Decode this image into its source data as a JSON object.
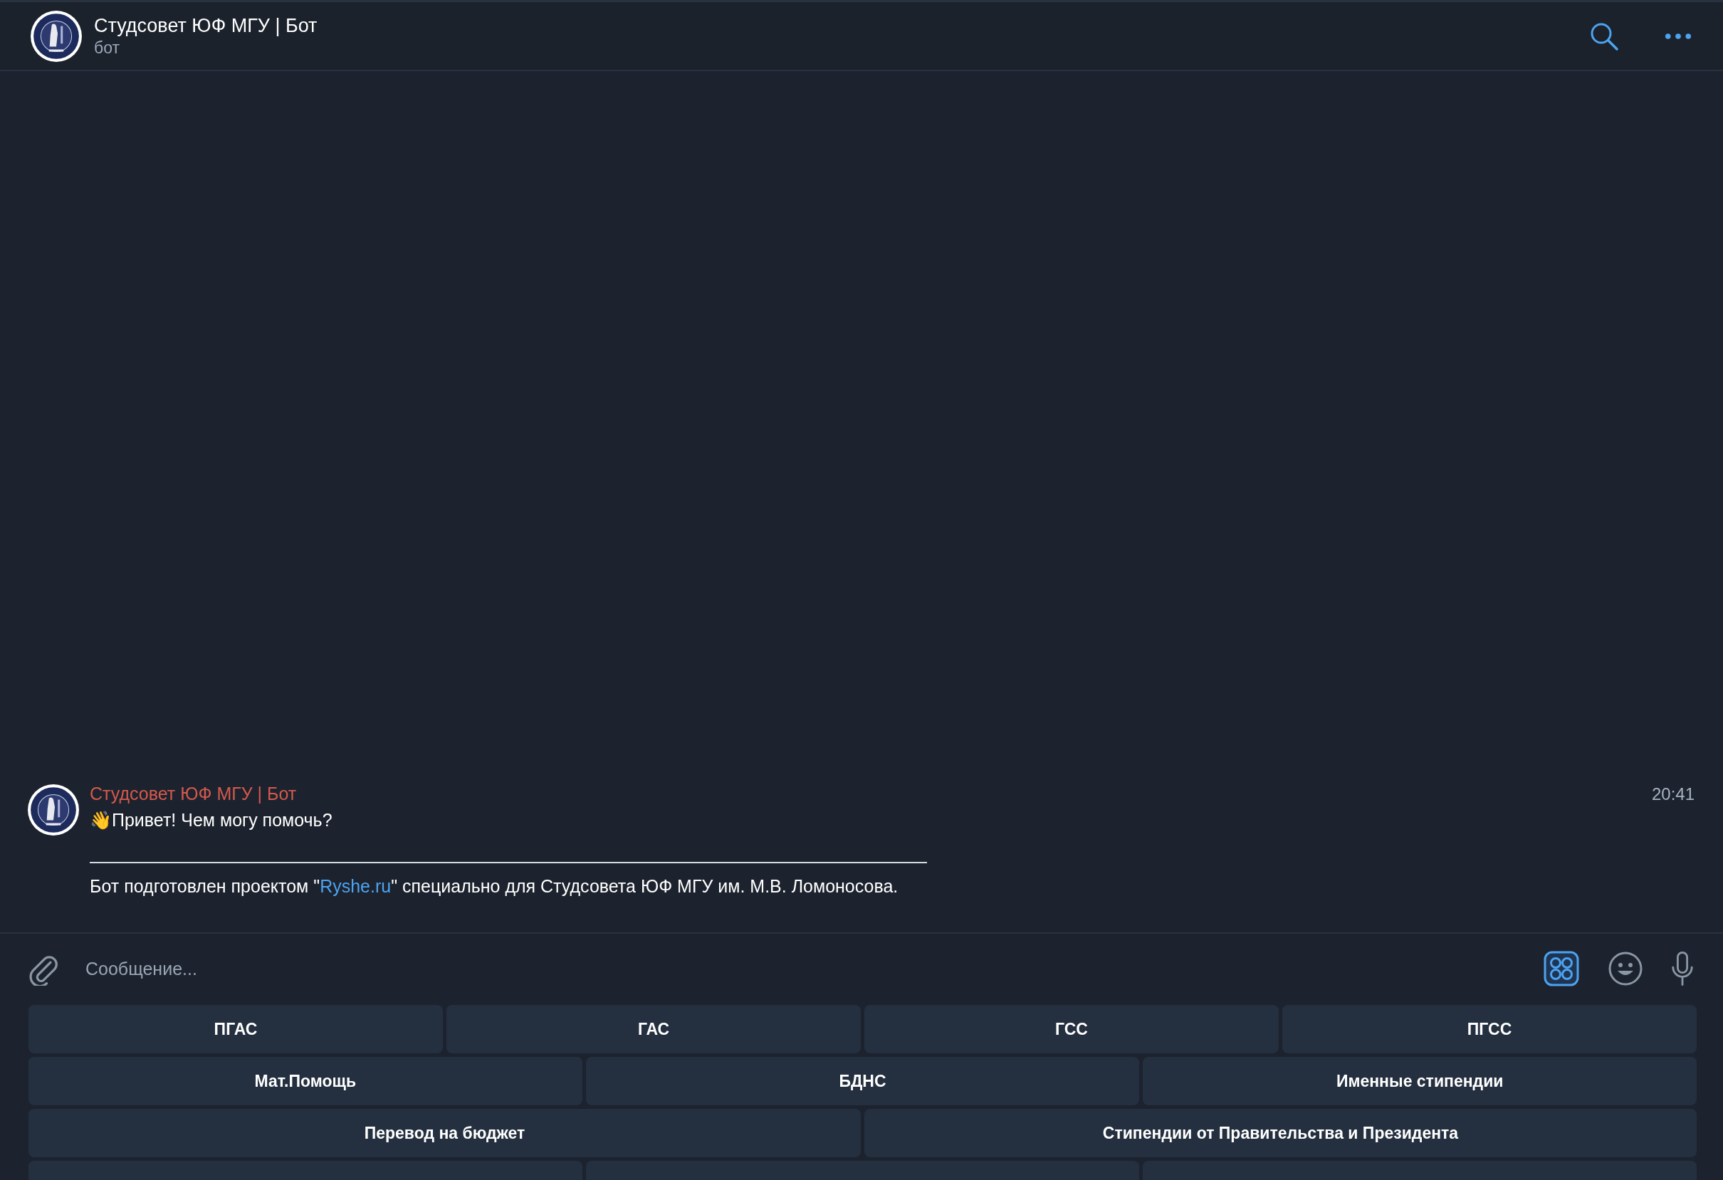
{
  "header": {
    "title": "Студсовет ЮФ МГУ | Бот",
    "subtitle": "бот"
  },
  "messages": [
    {
      "sender": "Студсовет ЮФ МГУ | Бот",
      "time": "20:41",
      "text": "👋Привет! Чем могу помочь?",
      "footer_before": "Бот подготовлен проектом \"",
      "link": "Ryshe.ru",
      "footer_after": "\" специально для Студсовета ЮФ МГУ им. М.В. Ломоносова."
    }
  ],
  "composer": {
    "placeholder": "Сообщение...",
    "keyboard_toggle_on": true
  },
  "keyboard": {
    "rows": [
      {
        "buttons": [
          "ПГАС",
          "ГАС",
          "ГСС",
          "ПГСС"
        ]
      },
      {
        "buttons": [
          "Мат.Помощь",
          "БДНС",
          "Именные стипендии"
        ]
      },
      {
        "buttons": [
          "Перевод на бюджет",
          "Стипендии от Правительства и Президента"
        ]
      }
    ]
  }
}
